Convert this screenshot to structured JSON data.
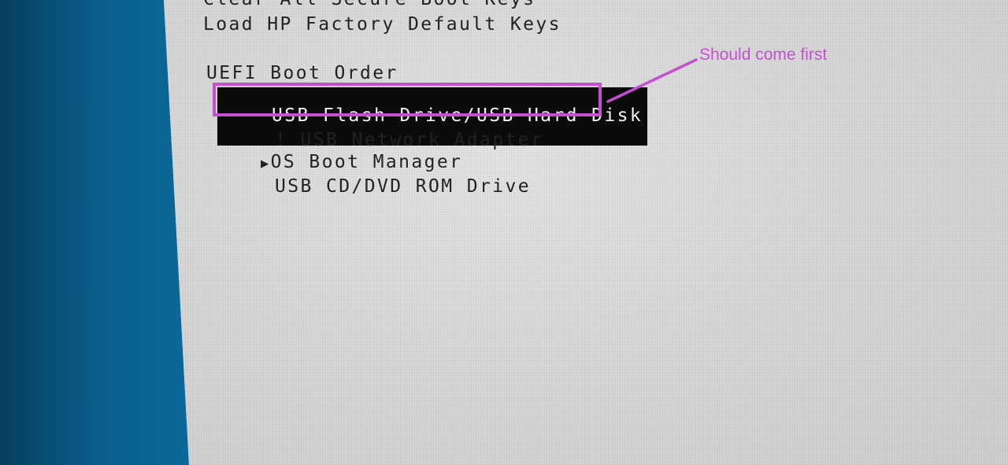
{
  "bios": {
    "partial_top_line": "Clear All Secure Boot Keys",
    "load_factory_keys": "Load HP Factory Default Keys",
    "boot_order_heading": "UEFI Boot Order",
    "items": [
      {
        "label": "USB Flash Drive/USB Hard Disk",
        "prefix": ""
      },
      {
        "label": "USB Network Adapter",
        "prefix": "! "
      },
      {
        "label": "OS Boot Manager",
        "prefix": "▶"
      },
      {
        "label": "USB CD/DVD ROM Drive",
        "prefix": ""
      }
    ]
  },
  "annotation": {
    "text": "Should come first",
    "color": "#c64fd1"
  },
  "colors": {
    "highlight_bg": "#0b0b0b",
    "highlight_fg": "#f2f2f2",
    "screen_bg": "#dcdcdc",
    "side_blue": "#0a5f8e"
  }
}
